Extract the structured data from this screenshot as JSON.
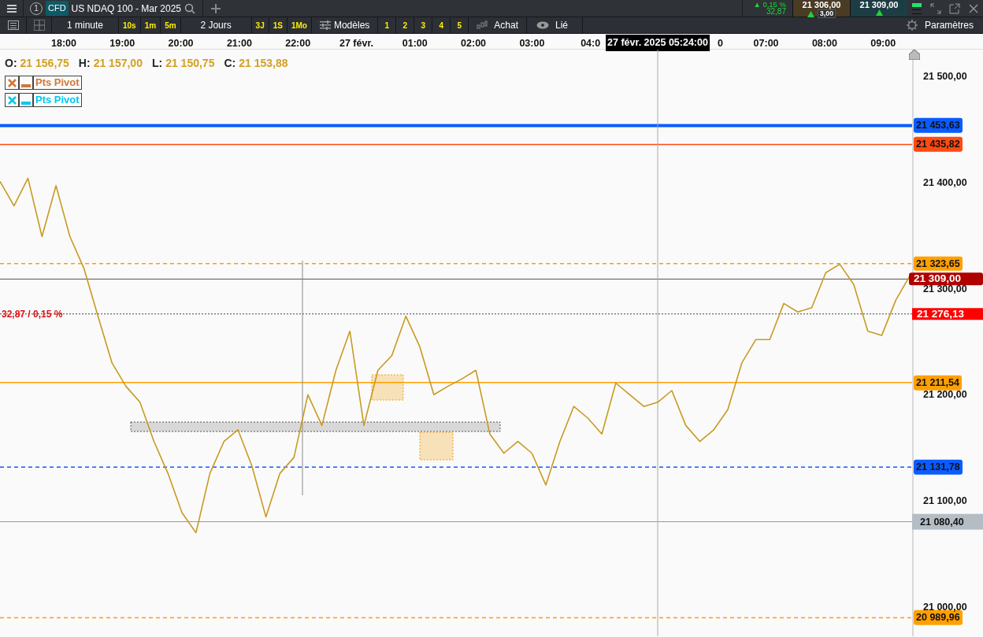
{
  "tab": {
    "number": "1",
    "badge": "CFD",
    "title": "US NDAQ 100 - Mar 2025"
  },
  "quote": {
    "change_pct": "▲ 0,15 %",
    "change": "32,87",
    "bid": "21 306,00",
    "ask": "21 309,00",
    "spread": "3,00"
  },
  "toolbar": {
    "interval": "1 minute",
    "interval_presets": [
      "10s",
      "1m",
      "5m"
    ],
    "range": "2 Jours",
    "range_presets": [
      "3J",
      "1S",
      "1Mo"
    ],
    "templates": "Modèles",
    "slots": [
      "1",
      "2",
      "3",
      "4",
      "5"
    ],
    "chart_type": "Achat",
    "link": "Lié",
    "settings": "Paramètres"
  },
  "time_axis": {
    "labels": [
      {
        "text": "18:00",
        "kind": "tick"
      },
      {
        "text": "19:00",
        "kind": "tick"
      },
      {
        "text": "20:00",
        "kind": "tick"
      },
      {
        "text": "21:00",
        "kind": "tick"
      },
      {
        "text": "22:00",
        "kind": "tick"
      },
      {
        "text": "27 févr.",
        "kind": "tick"
      },
      {
        "text": "01:00",
        "kind": "tick"
      },
      {
        "text": "02:00",
        "kind": "tick"
      },
      {
        "text": "03:00",
        "kind": "tick"
      },
      {
        "text": "04:0",
        "kind": "tick"
      },
      {
        "text": "0",
        "kind": "cut"
      },
      {
        "text": "07:00",
        "kind": "tick"
      },
      {
        "text": "08:00",
        "kind": "tick"
      },
      {
        "text": "09:00",
        "kind": "tick"
      }
    ],
    "crosshair_label": "27 févr. 2025 05:24:00"
  },
  "ohlc": [
    {
      "key": "O:",
      "value": "21 156,75"
    },
    {
      "key": "H:",
      "value": "21 157,00"
    },
    {
      "key": "L:",
      "value": "21 150,75"
    },
    {
      "key": "C:",
      "value": "21 153,88"
    }
  ],
  "indicators": [
    {
      "label": "Pts Pivot",
      "color": "#d2773a"
    },
    {
      "label": "Pts Pivot",
      "color": "#00c8f0"
    }
  ],
  "change_label": "32,87 / 0,15 %",
  "chart": {
    "chart_data": {
      "type": "line",
      "series": [
        {
          "color": "#c89a20",
          "values": [
            21401,
            21378,
            21404,
            21349,
            21397,
            21349,
            21319,
            21274,
            21230,
            21208,
            21193,
            21156,
            21126,
            21089,
            21070,
            21126,
            21156,
            21167,
            21133,
            21085,
            21126,
            21141,
            21200,
            21171,
            21223,
            21260,
            21171,
            21223,
            21237,
            21274,
            21245,
            21200,
            21208,
            21215,
            21223,
            21163,
            21145,
            21156,
            21145,
            21115,
            21156,
            21189,
            21178,
            21163,
            21211,
            21200,
            21189,
            21193,
            21204,
            21171,
            21156,
            21167,
            21186,
            21230,
            21252,
            21252,
            21286,
            21278,
            21282,
            21315,
            21323,
            21304,
            21260,
            21256,
            21289,
            21312
          ]
        }
      ],
      "ylim": [
        20972.5,
        21525.2
      ],
      "yticks": [
        {
          "value": 21500,
          "label": "21 500,00"
        },
        {
          "value": 21400,
          "label": "21 400,00"
        },
        {
          "value": 21300,
          "label": "21 300,00"
        },
        {
          "value": 21200,
          "label": "21 200,00"
        },
        {
          "value": 21100,
          "label": "21 100,00"
        },
        {
          "value": 21000,
          "label": "21 000,00"
        }
      ]
    }
  },
  "price_lines": [
    {
      "label": "21 453,63",
      "color": "#0a5cff",
      "kind": "thick"
    },
    {
      "label": "21 435,82",
      "color": "#ff4a10",
      "kind": "solid"
    },
    {
      "label": "21 323,65",
      "color": "#ffa000",
      "kind": "dashed"
    },
    {
      "label": "21 309,00",
      "color": "#b00000",
      "kind": "current"
    },
    {
      "label": "21 276,13",
      "color": "#ff0000",
      "kind": "dotted"
    },
    {
      "label": "21 211,54",
      "color": "#ffa000",
      "kind": "solid"
    },
    {
      "label": "21 131,78",
      "color": "#0a5cff",
      "kind": "dashed"
    },
    {
      "label": "21 080,40",
      "color": "#b4bcc4",
      "kind": "grey"
    },
    {
      "label": "20 989,96",
      "color": "#ffa000",
      "kind": "dashed"
    }
  ]
}
